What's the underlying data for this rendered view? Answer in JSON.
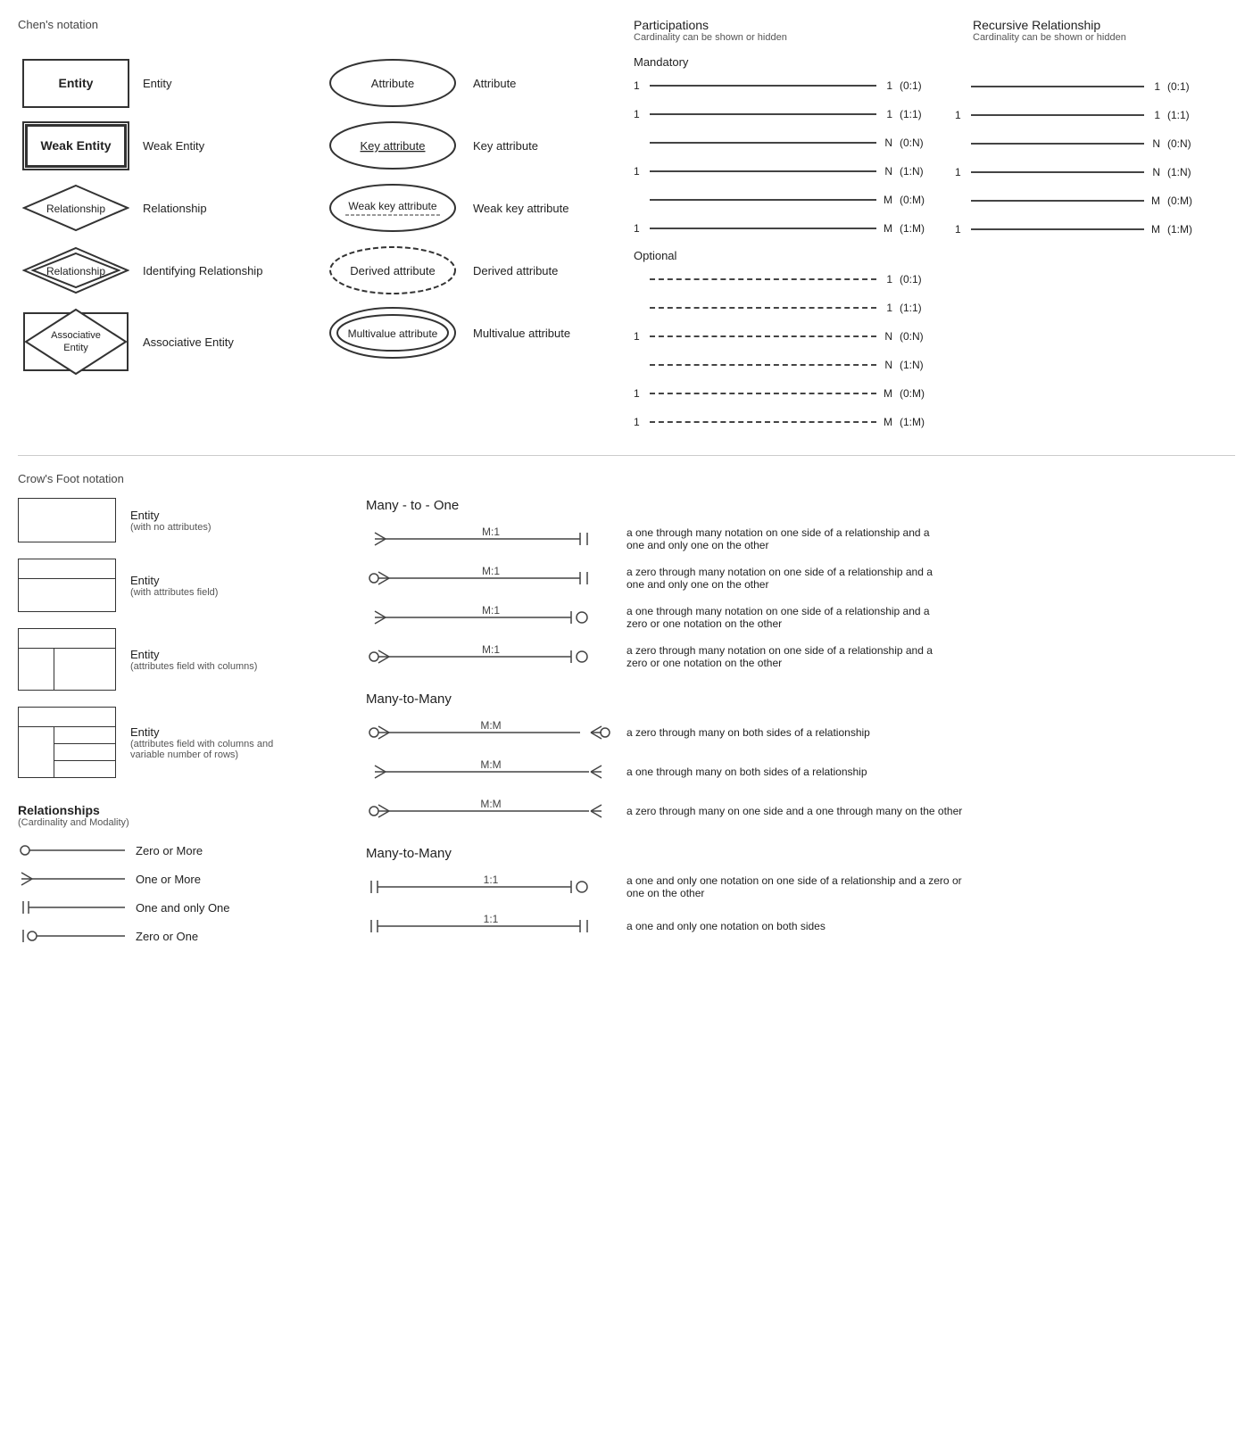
{
  "chens_title": "Chen's notation",
  "participations_title": "Participations",
  "participations_subtitle": "Cardinality can be shown or hidden",
  "recursive_title": "Recursive Relationship",
  "recursive_subtitle": "Cardinality can be shown or hidden",
  "crows_title": "Crow's Foot notation",
  "many_to_one_title": "Many - to - One",
  "many_to_many_title1": "Many-to-Many",
  "many_to_many_title2": "Many-to-Many",
  "chen_entities": [
    {
      "shape": "entity",
      "label": "Entity"
    },
    {
      "shape": "weak_entity",
      "label": "Weak Entity"
    },
    {
      "shape": "relationship",
      "label": "Relationship"
    },
    {
      "shape": "identifying_relationship",
      "label": "Identifying Relationship"
    },
    {
      "shape": "associative_entity",
      "label": "Associative Entity"
    }
  ],
  "chen_attributes": [
    {
      "shape": "attribute",
      "label": "Attribute"
    },
    {
      "shape": "key_attribute",
      "label": "Key attribute"
    },
    {
      "shape": "weak_key_attribute",
      "label": "Weak key attribute"
    },
    {
      "shape": "derived_attribute",
      "label": "Derived attribute"
    },
    {
      "shape": "multivalue_attribute",
      "label": "Multivalue attribute"
    }
  ],
  "entity_label": "Entity",
  "weak_entity_label": "Weak Entity",
  "relationship_label": "Relationship",
  "assoc_entity_label": "Associative\nEntity",
  "attribute_label": "Attribute",
  "key_attribute_label": "Key attribute",
  "weak_key_attribute_label": "Weak key attribute",
  "derived_attribute_label": "Derived attribute",
  "multivalue_attribute_label": "Multivalue attribute",
  "mandatory_label": "Mandatory",
  "optional_label": "Optional",
  "participation_rows_mandatory": [
    {
      "left": "1",
      "right": "1",
      "cardinality": "(0:1)"
    },
    {
      "left": "1",
      "right": "1",
      "cardinality": "(1:1)"
    },
    {
      "left": "",
      "right": "N",
      "cardinality": "(0:N)"
    },
    {
      "left": "1",
      "right": "N",
      "cardinality": "(1:N)"
    },
    {
      "left": "",
      "right": "M",
      "cardinality": "(0:M)"
    },
    {
      "left": "1",
      "right": "M",
      "cardinality": "(1:M)"
    }
  ],
  "participation_rows_optional": [
    {
      "left": "",
      "right": "1",
      "cardinality": "(0:1)"
    },
    {
      "left": "",
      "right": "1",
      "cardinality": "(1:1)"
    },
    {
      "left": "1",
      "right": "N",
      "cardinality": "(0:N)"
    },
    {
      "left": "",
      "right": "N",
      "cardinality": "(1:N)"
    },
    {
      "left": "1",
      "right": "M",
      "cardinality": "(0:M)"
    },
    {
      "left": "1",
      "right": "M",
      "cardinality": "(1:M)"
    }
  ],
  "recursive_mandatory": [
    {
      "left": "",
      "right": "1",
      "cardinality": "(0:1)"
    },
    {
      "left": "1",
      "right": "1",
      "cardinality": "(1:1)"
    },
    {
      "left": "",
      "right": "N",
      "cardinality": "(0:N)"
    },
    {
      "left": "1",
      "right": "N",
      "cardinality": "(1:N)"
    },
    {
      "left": "",
      "right": "M",
      "cardinality": "(0:M)"
    },
    {
      "left": "1",
      "right": "M",
      "cardinality": "(1:M)"
    }
  ],
  "cf_entities": [
    {
      "label": "Entity",
      "sublabel": "(with no attributes)",
      "shape": "simple"
    },
    {
      "label": "Entity",
      "sublabel": "(with attributes field)",
      "shape": "attrs"
    },
    {
      "label": "Entity",
      "sublabel": "(attributes field with columns)",
      "shape": "cols"
    },
    {
      "label": "Entity",
      "sublabel": "(attributes field with columns and\nvariable number of rows)",
      "shape": "variable"
    }
  ],
  "cf_relations": [
    {
      "symbol": "zero_or_more",
      "label": "Zero or More"
    },
    {
      "symbol": "one_or_more",
      "label": "One or More"
    },
    {
      "symbol": "one_only",
      "label": "One and only One"
    },
    {
      "symbol": "zero_or_one",
      "label": "Zero or One"
    }
  ],
  "m2o_rows": [
    {
      "label": "M:1",
      "left_symbol": "many_one",
      "right_symbol": "one_only",
      "desc": "a one through many notation on one side of a relationship and a one and only one on the other"
    },
    {
      "label": "M:1",
      "left_symbol": "many_zero",
      "right_symbol": "one_only",
      "desc": "a zero through many notation on one side of a relationship and a one and only one on the other"
    },
    {
      "label": "M:1",
      "left_symbol": "many_one",
      "right_symbol": "zero_one",
      "desc": "a one through many notation on one side of a relationship and a zero or one notation on the other"
    },
    {
      "label": "M:1",
      "left_symbol": "many_zero",
      "right_symbol": "zero_one",
      "desc": "a zero through many notation on one side of a relationship and a zero or one notation on the other"
    }
  ],
  "m2m_rows": [
    {
      "label": "M:M",
      "left_symbol": "many_zero",
      "right_symbol": "many_zero_r",
      "desc": "a zero through many on both sides of a relationship"
    },
    {
      "label": "M:M",
      "left_symbol": "many_one",
      "right_symbol": "many_one_r",
      "desc": "a one through many on both sides of a relationship"
    },
    {
      "label": "M:M",
      "left_symbol": "many_zero",
      "right_symbol": "many_one_r",
      "desc": "a zero through many on one side and a one through many on the other"
    }
  ],
  "one_to_one_rows": [
    {
      "label": "1:1",
      "left_symbol": "one_only",
      "right_symbol": "zero_one",
      "desc": "a one and only one notation on one side of a relationship and a zero or one on the other"
    },
    {
      "label": "1:1",
      "left_symbol": "one_only",
      "right_symbol": "one_only_r",
      "desc": "a one and only one notation on both sides"
    }
  ]
}
